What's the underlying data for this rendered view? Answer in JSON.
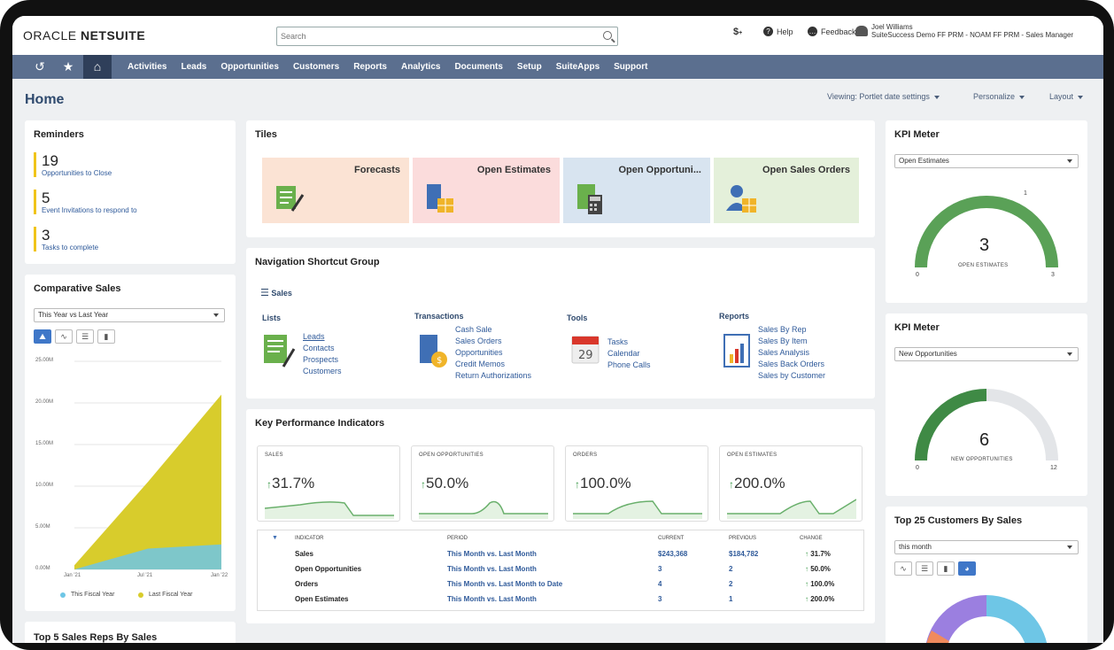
{
  "header": {
    "logo_part1": "ORACLE",
    "logo_part2": "NETSUITE",
    "search_placeholder": "Search",
    "help_label": "Help",
    "feedback_label": "Feedback",
    "user_name": "Joel Williams",
    "user_role": "SuiteSuccess Demo FF PRM - NOAM FF PRM - Sales Manager"
  },
  "nav": {
    "items": [
      "Activities",
      "Leads",
      "Opportunities",
      "Customers",
      "Reports",
      "Analytics",
      "Documents",
      "Setup",
      "SuiteApps",
      "Support"
    ]
  },
  "page": {
    "title": "Home",
    "viewing": "Viewing: Portlet date settings",
    "personalize": "Personalize",
    "layout": "Layout"
  },
  "reminders": {
    "title": "Reminders",
    "items": [
      {
        "count": "19",
        "label": "Opportunities to Close"
      },
      {
        "count": "5",
        "label": "Event Invitations to respond to"
      },
      {
        "count": "3",
        "label": "Tasks to complete"
      }
    ]
  },
  "comparative_sales": {
    "title": "Comparative Sales",
    "select": "This Year vs Last Year",
    "y_ticks": [
      "25.00M",
      "20.00M",
      "15.00M",
      "10.00M",
      "5.00M",
      "0.00M"
    ],
    "x_ticks": [
      "Jan '21",
      "Jul '21",
      "Jan '22"
    ],
    "legend": [
      "This Fiscal Year",
      "Last Fiscal Year"
    ]
  },
  "chart_data": {
    "type": "area",
    "x": [
      "Jan '21",
      "Jul '21",
      "Jan '22"
    ],
    "ylim": [
      0,
      25
    ],
    "series": [
      {
        "name": "This Fiscal Year",
        "color": "#6ec6e6",
        "values": [
          0,
          2.5,
          3.0
        ]
      },
      {
        "name": "Last Fiscal Year",
        "color": "#d8cc2c",
        "values": [
          0.5,
          10.5,
          21.0
        ]
      }
    ],
    "grid": true,
    "legend": "bottom"
  },
  "bottom_left_title": "Top 5 Sales Reps By Sales",
  "tiles": {
    "title": "Tiles",
    "items": [
      {
        "label": "Forecasts",
        "bg": "#fbe3d4"
      },
      {
        "label": "Open Estimates",
        "bg": "#fbdcdc"
      },
      {
        "label": "Open Opportuni...",
        "bg": "#d8e4f0"
      },
      {
        "label": "Open Sales Orders",
        "bg": "#e4f0da"
      }
    ]
  },
  "nav_shortcuts": {
    "title": "Navigation Shortcut Group",
    "group": "Sales",
    "lists": {
      "head": "Lists",
      "links": [
        "Leads",
        "Contacts",
        "Prospects",
        "Customers"
      ]
    },
    "transactions": {
      "head": "Transactions",
      "links": [
        "Cash Sale",
        "Sales Orders",
        "Opportunities",
        "Credit Memos",
        "Return Authorizations"
      ]
    },
    "tools": {
      "head": "Tools",
      "links": [
        "Tasks",
        "Calendar",
        "Phone Calls"
      ]
    },
    "reports": {
      "head": "Reports",
      "links": [
        "Sales By Rep",
        "Sales By Item",
        "Sales Analysis",
        "Sales Back Orders",
        "Sales by Customer"
      ]
    }
  },
  "kpi": {
    "title": "Key Performance Indicators",
    "cards": [
      {
        "label": "SALES",
        "value": "31.7%"
      },
      {
        "label": "OPEN OPPORTUNITIES",
        "value": "50.0%"
      },
      {
        "label": "ORDERS",
        "value": "100.0%"
      },
      {
        "label": "OPEN ESTIMATES",
        "value": "200.0%"
      }
    ],
    "table": {
      "headers": [
        "INDICATOR",
        "PERIOD",
        "CURRENT",
        "PREVIOUS",
        "CHANGE"
      ],
      "rows": [
        {
          "indicator": "Sales",
          "period": "This Month vs. Last Month",
          "current": "$243,368",
          "previous": "$184,782",
          "change": "31.7%"
        },
        {
          "indicator": "Open Opportunities",
          "period": "This Month vs. Last Month",
          "current": "3",
          "previous": "2",
          "change": "50.0%"
        },
        {
          "indicator": "Orders",
          "period": "This Month vs. Last Month to Date",
          "current": "4",
          "previous": "2",
          "change": "100.0%"
        },
        {
          "indicator": "Open Estimates",
          "period": "This Month vs. Last Month",
          "current": "3",
          "previous": "1",
          "change": "200.0%"
        }
      ]
    }
  },
  "kpi_meter_1": {
    "title": "KPI Meter",
    "select": "Open Estimates",
    "value": "3",
    "label": "OPEN ESTIMATES",
    "min": "0",
    "max": "3",
    "target": "1",
    "fraction": 1.0
  },
  "kpi_meter_2": {
    "title": "KPI Meter",
    "select": "New Opportunities",
    "value": "6",
    "label": "NEW OPPORTUNITIES",
    "min": "0",
    "max": "12",
    "fraction": 0.5
  },
  "top_customers": {
    "title": "Top 25 Customers By Sales",
    "select": "this month"
  }
}
